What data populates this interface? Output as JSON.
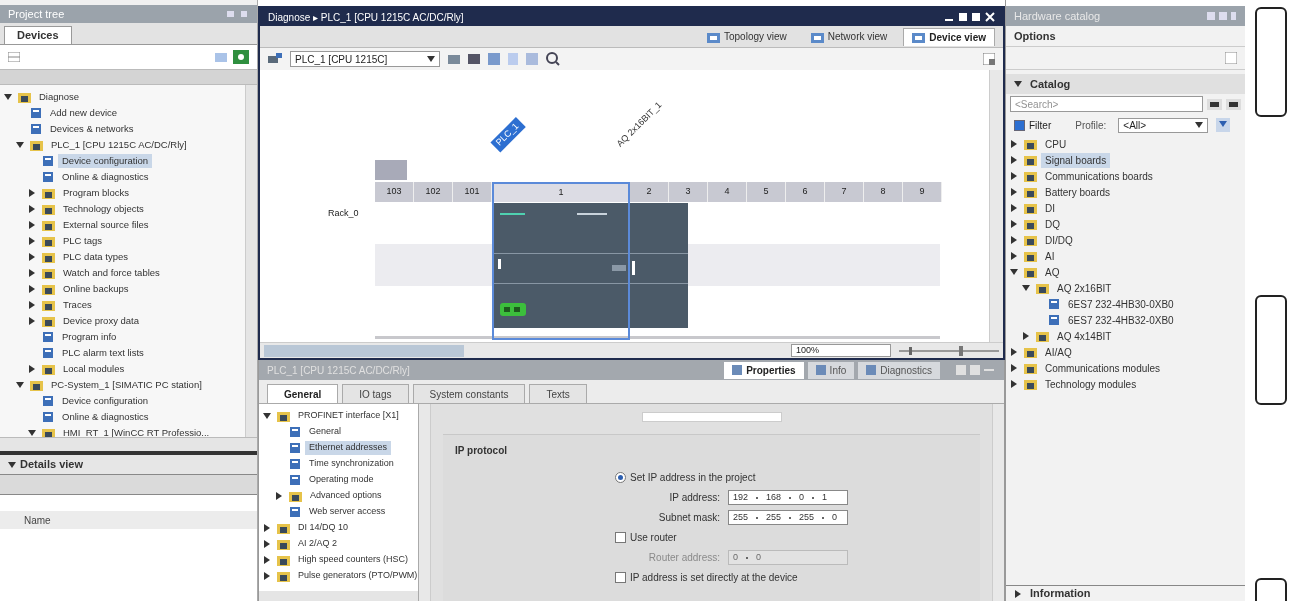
{
  "project_tree": {
    "title": "Project tree",
    "tab": "Devices",
    "items": [
      {
        "label": "Diagnose",
        "expanded": true,
        "selected": false,
        "children": [
          {
            "label": "Add new device",
            "selected": false
          },
          {
            "label": "Devices & networks",
            "selected": false
          },
          {
            "label": "PLC_1 [CPU 1215C AC/DC/Rly]",
            "expanded": true,
            "selected": false,
            "children": [
              {
                "label": "Device configuration",
                "selected": true
              },
              {
                "label": "Online & diagnostics",
                "selected": false
              },
              {
                "label": "Program blocks",
                "expanded": false,
                "selected": false
              },
              {
                "label": "Technology objects",
                "expanded": false,
                "selected": false
              },
              {
                "label": "External source files",
                "expanded": false,
                "selected": false
              },
              {
                "label": "PLC tags",
                "expanded": false,
                "selected": false
              },
              {
                "label": "PLC data types",
                "expanded": false,
                "selected": false
              },
              {
                "label": "Watch and force tables",
                "expanded": false,
                "selected": false
              },
              {
                "label": "Online backups",
                "expanded": false,
                "selected": false
              },
              {
                "label": "Traces",
                "expanded": false,
                "selected": false
              },
              {
                "label": "Device proxy data",
                "expanded": false,
                "selected": false
              },
              {
                "label": "Program info",
                "selected": false
              },
              {
                "label": "PLC alarm text lists",
                "selected": false
              },
              {
                "label": "Local modules",
                "expanded": false,
                "selected": false
              }
            ]
          },
          {
            "label": "PC-System_1 [SIMATIC PC station]",
            "expanded": true,
            "selected": false,
            "children": [
              {
                "label": "Device configuration",
                "selected": false
              },
              {
                "label": "Online & diagnostics",
                "selected": false
              },
              {
                "label": "HMI_RT_1 [WinCC RT Professio...",
                "expanded": true,
                "selected": false
              }
            ]
          }
        ]
      }
    ]
  },
  "details_view": {
    "title": "Details view",
    "column": "Name"
  },
  "editor": {
    "breadcrumb": "Diagnose ▸ PLC_1 [CPU 1215C AC/DC/Rly]",
    "views": [
      {
        "label": "Topology view",
        "selected": false
      },
      {
        "label": "Network view",
        "selected": false
      },
      {
        "label": "Device view",
        "selected": true
      }
    ],
    "device_select": "PLC_1 [CPU 1215C]",
    "device_label": "PLC_1",
    "module_label": "AQ 2x16BIT_1",
    "rack": "Rack_0",
    "slots": [
      {
        "label": "103",
        "selected": false
      },
      {
        "label": "102",
        "selected": false
      },
      {
        "label": "101",
        "selected": false
      },
      {
        "label": "1",
        "selected": true
      },
      {
        "label": "2",
        "selected": false
      },
      {
        "label": "3",
        "selected": false
      },
      {
        "label": "4",
        "selected": false
      },
      {
        "label": "5",
        "selected": false
      },
      {
        "label": "6",
        "selected": false
      },
      {
        "label": "7",
        "selected": false
      },
      {
        "label": "8",
        "selected": false
      },
      {
        "label": "9",
        "selected": false
      }
    ],
    "zoom": "100%"
  },
  "inspector": {
    "title": "PLC_1 [CPU 1215C AC/DC/Rly]",
    "tabs": [
      {
        "label": "Properties",
        "selected": true
      },
      {
        "label": "Info",
        "selected": false
      },
      {
        "label": "Diagnostics",
        "selected": false
      }
    ],
    "subtabs": [
      {
        "label": "General",
        "selected": true
      },
      {
        "label": "IO tags",
        "selected": false
      },
      {
        "label": "System constants",
        "selected": false
      },
      {
        "label": "Texts",
        "selected": false
      }
    ],
    "nav": [
      {
        "label": "PROFINET interface [X1]",
        "expanded": true,
        "selected": false,
        "children": [
          {
            "label": "General",
            "selected": false
          },
          {
            "label": "Ethernet addresses",
            "selected": true
          },
          {
            "label": "Time synchronization",
            "selected": false
          },
          {
            "label": "Operating mode",
            "selected": false
          },
          {
            "label": "Advanced options",
            "expanded": false,
            "selected": false
          },
          {
            "label": "Web server access",
            "selected": false
          }
        ]
      },
      {
        "label": "DI 14/DQ 10",
        "expanded": false,
        "selected": false
      },
      {
        "label": "AI 2/AQ 2",
        "expanded": false,
        "selected": false
      },
      {
        "label": "High speed counters (HSC)",
        "expanded": false,
        "selected": false
      },
      {
        "label": "Pulse generators (PTO/PWM)",
        "expanded": false,
        "selected": false
      }
    ],
    "section": "IP protocol",
    "set_ip": {
      "label": "Set IP address in the project",
      "selected": true
    },
    "fields": [
      {
        "label": "IP address:",
        "octets": [
          "192",
          "168",
          "0",
          "1"
        ],
        "disabled": false
      },
      {
        "label": "Subnet mask:",
        "octets": [
          "255",
          "255",
          "255",
          "0"
        ],
        "disabled": false
      }
    ],
    "use_router": {
      "label": "Use router",
      "checked": false
    },
    "router": {
      "label": "Router address:",
      "octets": [
        "0",
        "0"
      ],
      "disabled": true
    },
    "set_direct": {
      "label": "IP address is set directly at the device",
      "checked": false
    }
  },
  "catalog": {
    "title": "Hardware catalog",
    "options": "Options",
    "section": "Catalog",
    "search_placeholder": "<Search>",
    "filter": {
      "label": "Filter",
      "checked": true
    },
    "profile_label": "Profile:",
    "profile": "<All>",
    "items": [
      {
        "label": "CPU",
        "expanded": false,
        "selected": false
      },
      {
        "label": "Signal boards",
        "expanded": false,
        "selected": true
      },
      {
        "label": "Communications boards",
        "expanded": false,
        "selected": false
      },
      {
        "label": "Battery boards",
        "expanded": false,
        "selected": false
      },
      {
        "label": "DI",
        "expanded": false,
        "selected": false
      },
      {
        "label": "DQ",
        "expanded": false,
        "selected": false
      },
      {
        "label": "DI/DQ",
        "expanded": false,
        "selected": false
      },
      {
        "label": "AI",
        "expanded": false,
        "selected": false
      },
      {
        "label": "AQ",
        "expanded": true,
        "selected": false,
        "children": [
          {
            "label": "AQ 2x16BIT",
            "expanded": true,
            "selected": false,
            "children": [
              {
                "label": "6ES7 232-4HB30-0XB0",
                "selected": false
              },
              {
                "label": "6ES7 232-4HB32-0XB0",
                "selected": false
              }
            ]
          },
          {
            "label": "AQ 4x14BIT",
            "expanded": false,
            "selected": false
          }
        ]
      },
      {
        "label": "AI/AQ",
        "expanded": false,
        "selected": false
      },
      {
        "label": "Communications modules",
        "expanded": false,
        "selected": false
      },
      {
        "label": "Technology modules",
        "expanded": false,
        "selected": false
      }
    ],
    "information": "Information"
  }
}
